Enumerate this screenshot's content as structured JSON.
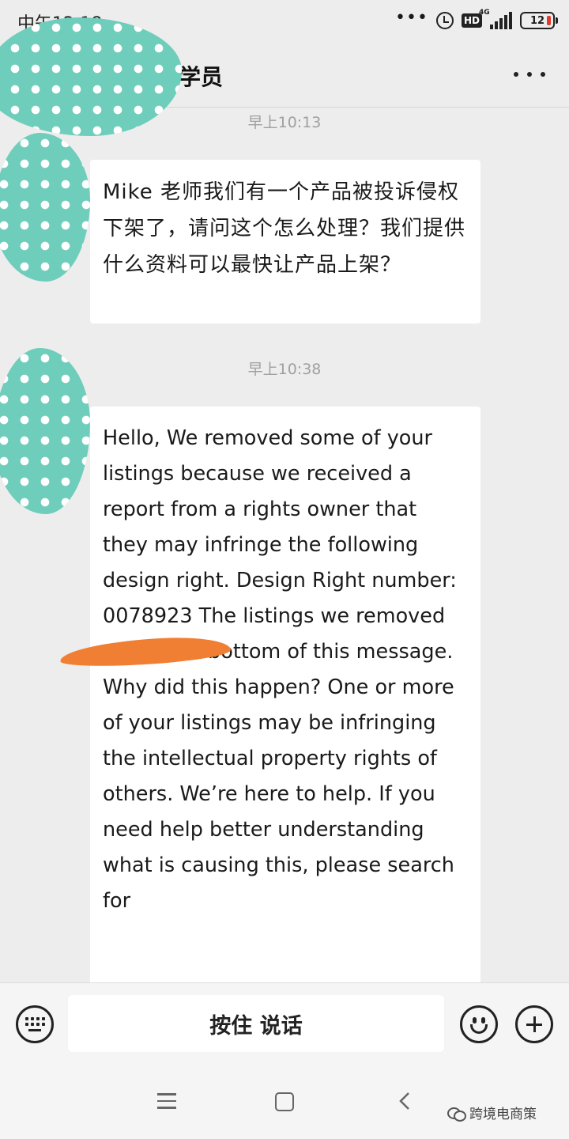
{
  "status_bar": {
    "time": "中午12:18",
    "battery": "12",
    "network": "4G",
    "hd": "HD",
    "more_dots": "•••"
  },
  "header": {
    "title": "学员"
  },
  "messages": [
    {
      "timestamp": "早上10:13",
      "text": "Mike 老师我们有一个产品被投诉侵权下架了，请问这个怎么处理？我们提供什么资料可以最快让产品上架？"
    },
    {
      "timestamp": "早上10:38",
      "text": "Hello,    We removed some of your listings because we received a report from a rights owner that they may infringe the following design right. Design Right number: 0078923  The listings we removed are at the bottom of this message.   Why did this happen? One or more of your listings may be infringing the intellectual property rights of others.   We’re here to help. If you need help better understanding what is causing this, please search for"
    }
  ],
  "input_bar": {
    "talk_label": "按住 说话"
  },
  "watermark": {
    "text": "跨境电商策"
  },
  "colors": {
    "background": "#ededed",
    "bubble": "#ffffff",
    "privacy_blob": "#6fcdbb",
    "redaction": "#f07f33"
  }
}
